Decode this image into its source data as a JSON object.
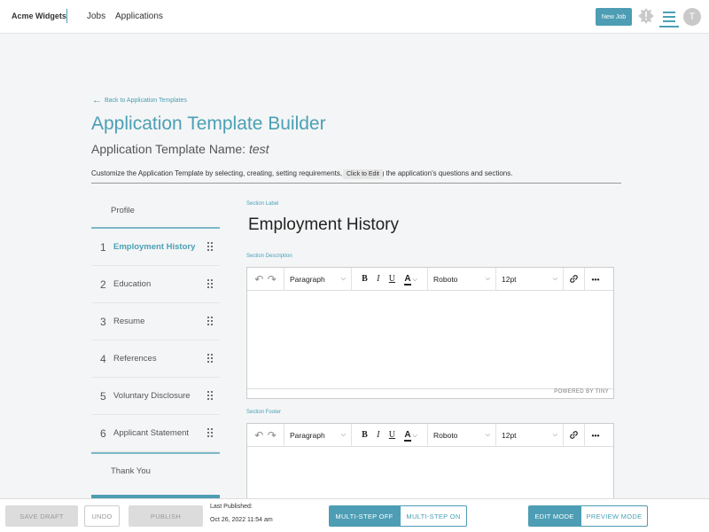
{
  "app": {
    "brand": "Acme Widgets",
    "nav": [
      {
        "label": "Jobs"
      },
      {
        "label": "Applications"
      }
    ],
    "new_job_label": "New Job",
    "avatar_initial": "T",
    "accent_color": "#4aa0b5"
  },
  "header": {
    "back_link": "Back to Application Templates",
    "title": "Application Template Builder",
    "template_name_label": "Application Template Name:",
    "template_name_value": "test",
    "instructions": "Customize the Application Template by selecting, creating, setting requirements, and ordering the application's questions and sections.",
    "tooltip": "Click to Edit"
  },
  "sidebar": {
    "profile": "Profile",
    "items": [
      {
        "num": "1",
        "label": "Employment History",
        "active": true
      },
      {
        "num": "2",
        "label": "Education"
      },
      {
        "num": "3",
        "label": "Resume"
      },
      {
        "num": "4",
        "label": "References"
      },
      {
        "num": "5",
        "label": "Voluntary Disclosure"
      },
      {
        "num": "6",
        "label": "Applicant Statement"
      }
    ],
    "thank_you": "Thank You"
  },
  "section": {
    "label_caption": "Section Label",
    "label_value": "Employment History",
    "description_caption": "Section Description",
    "footer_caption": "Section Footer",
    "toolbar": {
      "block_format": "Paragraph",
      "bold": "B",
      "italic": "I",
      "underline": "U",
      "text_color": "A",
      "font": "Roboto",
      "size": "12pt",
      "more": "•••"
    },
    "powered_by": "POWERED BY TINY"
  },
  "footer": {
    "save_draft": "SAVE DRAFT",
    "undo": "UNDO",
    "publish": "PUBLISH",
    "last_published_label": "Last Published:",
    "last_published_date": "Oct 26, 2022 11:54 am",
    "multistep_off": "MULTI-STEP OFF",
    "multistep_on": "MULTI-STEP ON",
    "edit_mode": "EDIT MODE",
    "preview_mode": "PREVIEW MODE"
  }
}
